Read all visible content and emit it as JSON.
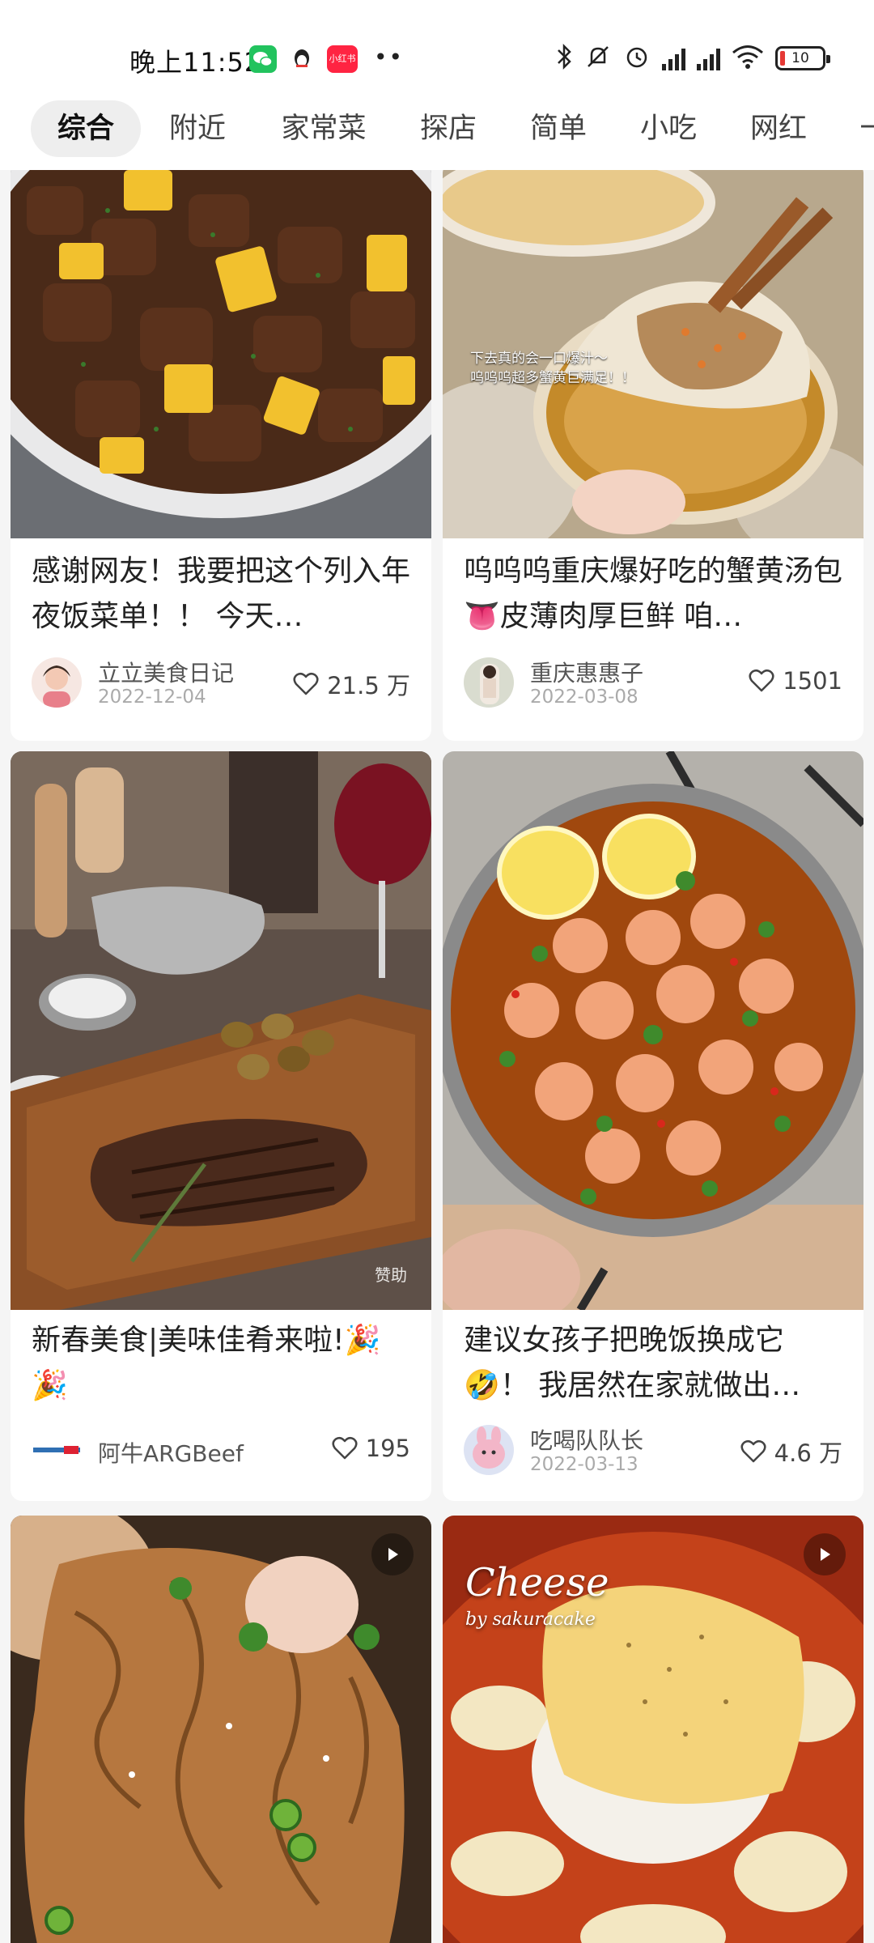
{
  "status_bar": {
    "time": "晚上11:52",
    "xhs_badge": "小红书",
    "battery": "10",
    "colors": {
      "battery_low": "#e53935",
      "wechat": "#22c35e",
      "xhs": "#ff2442"
    }
  },
  "tabs": [
    {
      "label": "综合",
      "active": true
    },
    {
      "label": "附近"
    },
    {
      "label": "家常菜"
    },
    {
      "label": "探店"
    },
    {
      "label": "简单"
    },
    {
      "label": "小吃"
    },
    {
      "label": "网红"
    },
    {
      "label": "一"
    }
  ],
  "feed": {
    "cards": [
      {
        "title": "感谢网友！我要把这个列入年夜饭菜单！！ 今天…",
        "author": "立立美食日记",
        "date": "2022-12-04",
        "likes": "21.5 万",
        "image": "pineapple-beef-cubes"
      },
      {
        "title": "呜呜呜重庆爆好吃的蟹黄汤包👅皮薄肉厚巨鲜 咱…",
        "author": "重庆惠惠子",
        "date": "2022-03-08",
        "likes": "1501",
        "image_caption_line1": "下去真的会一口爆汁～",
        "image_caption_line2": "呜呜呜超多蟹黄巨满足！！",
        "image": "crab-soup-dumpling"
      },
      {
        "title": "新春美食|美味佳肴来啦!🎉🎉",
        "author": "阿牛ARGBeef",
        "likes": "195",
        "watermark": "赞助",
        "image": "steak-board"
      },
      {
        "title": "建议女孩子把晚饭换成它🤣！ 我居然在家就做出…",
        "author": "吃喝队队长",
        "date": "2022-03-13",
        "likes": "4.6 万",
        "image": "lemon-shrimp-pot"
      },
      {
        "title": "",
        "image": "spicy-beef-slices",
        "is_video": true
      },
      {
        "title": "",
        "image": "cheese-rice",
        "is_video": true,
        "image_overlay_big": "Cheese",
        "image_overlay_small": "by sakuracake"
      }
    ]
  }
}
